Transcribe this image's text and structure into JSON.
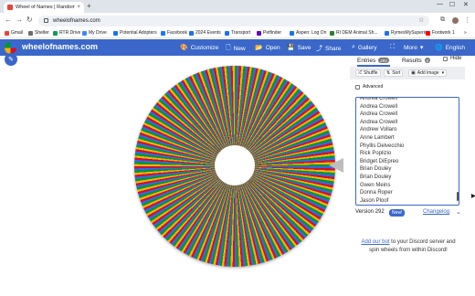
{
  "browser": {
    "tab_title": "Wheel of Names | Random Na",
    "tab_close": "×",
    "new_tab": "+",
    "url": "wheelofnames.com",
    "bookmarks": [
      {
        "label": "Gmail",
        "color": "#ea4335"
      },
      {
        "label": "Shelter",
        "color": "#6d6d6d"
      },
      {
        "label": "RTR Drive",
        "color": "#0f9d58"
      },
      {
        "label": "My Drive",
        "color": "#4285f4"
      },
      {
        "label": "Potential Adopters",
        "color": "#1a73e8"
      },
      {
        "label": "Facebook",
        "color": "#1877f2"
      },
      {
        "label": "2024 Events",
        "color": "#1a73e8"
      },
      {
        "label": "Transport",
        "color": "#1a73e8"
      },
      {
        "label": "Petfinder",
        "color": "#6504b5"
      },
      {
        "label": "Aspen: Log On",
        "color": "#1a73e8"
      },
      {
        "label": "RI DEM Animal Sh...",
        "color": "#2e7d32"
      },
      {
        "label": "RymesMySuperior",
        "color": "#1a73e8"
      },
      {
        "label": "Footwork 1",
        "color": "#ff0000"
      }
    ]
  },
  "app": {
    "site_name": "wheelofnames.com",
    "header_buttons": [
      {
        "key": "customize",
        "label": "Customize",
        "icon": "palette-icon",
        "glyph": "🎨"
      },
      {
        "key": "new",
        "label": "New",
        "icon": "new-file-icon",
        "glyph": "🗋"
      },
      {
        "key": "open",
        "label": "Open",
        "icon": "folder-icon",
        "glyph": "📂"
      },
      {
        "key": "save",
        "label": "Save",
        "icon": "save-icon",
        "glyph": "💾"
      },
      {
        "key": "share",
        "label": "Share",
        "icon": "share-icon",
        "glyph": "⤴"
      },
      {
        "key": "gallery",
        "label": "Gallery",
        "icon": "search-icon",
        "glyph": "⌕"
      },
      {
        "key": "fullscreen",
        "label": "",
        "icon": "fullscreen-icon",
        "glyph": "⛶"
      },
      {
        "key": "more",
        "label": "More",
        "icon": "chevron-down-icon",
        "glyph": "▾"
      },
      {
        "key": "language",
        "label": "English",
        "icon": "globe-icon",
        "glyph": "🌐"
      }
    ],
    "wheel_colors": [
      "#3369e8",
      "#d50f25",
      "#eeb211",
      "#009925"
    ]
  },
  "panel": {
    "tabs": [
      {
        "label": "Entries",
        "count": "292"
      },
      {
        "label": "Results",
        "count": "0"
      }
    ],
    "hide_label": "Hide",
    "tools": {
      "shuffle": "Shuffle",
      "sort": "Sort",
      "add_image": "Add image"
    },
    "advanced_label": "Advanced",
    "entries": [
      "Andrea Crowell",
      "Andrea Crowell",
      "Andrea Crowell",
      "Andrea Crowell",
      "Andrew Vollaro",
      "Anne Lambert",
      "Phyllis Delvecchio",
      "Rick Poplizio",
      "Bridget DiEpreo",
      "Brian Douley",
      "Brian Douley",
      "Gwen Meins",
      "Donna Roper",
      "Jason Ploof"
    ],
    "version": "Version 292",
    "new_badge": "New!",
    "changelog": "Changelog",
    "discord": {
      "link": "Add our bot",
      "text": " to your Discord server and spin wheels from within Discord!"
    }
  }
}
